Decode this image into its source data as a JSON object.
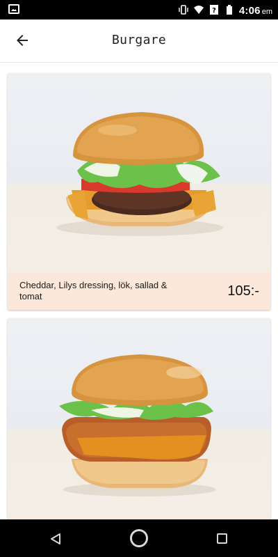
{
  "status": {
    "time": "4:06",
    "ampm": "em"
  },
  "app_bar": {
    "title": "Burgare"
  },
  "items": [
    {
      "description": "Cheddar, Lilys dressing, lök, sallad & tomat",
      "price": "105:-"
    },
    {
      "description": "",
      "price": ""
    }
  ],
  "colors": {
    "footer": "#fbe8db",
    "statusbar": "#000000"
  }
}
